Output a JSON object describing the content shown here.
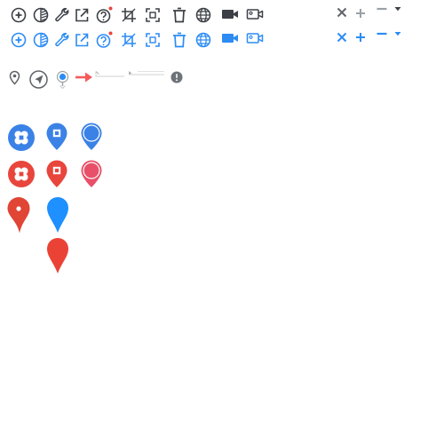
{
  "sprite_sheet": {
    "colors": {
      "dark": "#3c4046",
      "blue": "#2c8cf4",
      "light_gray": "#9aa0a6",
      "red": "#e8453c",
      "dark_red": "#d93025",
      "pin_blue": "#3b82e6",
      "drop_blue": "#1e90ff",
      "drop_red": "#ea4335",
      "arrow_red": "#f45b5b",
      "line_gray": "#c8c8c8",
      "alert_gray": "#6e7378"
    },
    "toolbar_icons": [
      "add-circle-icon",
      "compare-icon",
      "wrench-icon",
      "share-icon",
      "help-badge-icon",
      "crop-icon",
      "fullscreen-icon",
      "trash-icon",
      "globe-icon",
      "video-camera-icon",
      "camcorder-outline-icon"
    ],
    "window_controls": [
      "close-icon",
      "plus-icon",
      "minus-icon",
      "dropdown-caret-icon"
    ],
    "marker_tools": [
      "map-pin-outline-icon",
      "navigate-icon",
      "pin-drop-icon",
      "red-arrow-icon",
      "line-segment-icon",
      "line-arrow-icon",
      "alert-circle-icon"
    ],
    "markers": [
      "clover-circle-marker-icon",
      "square-pin-marker-icon",
      "circle-pin-marker-icon",
      "teardrop-marker-icon"
    ]
  }
}
